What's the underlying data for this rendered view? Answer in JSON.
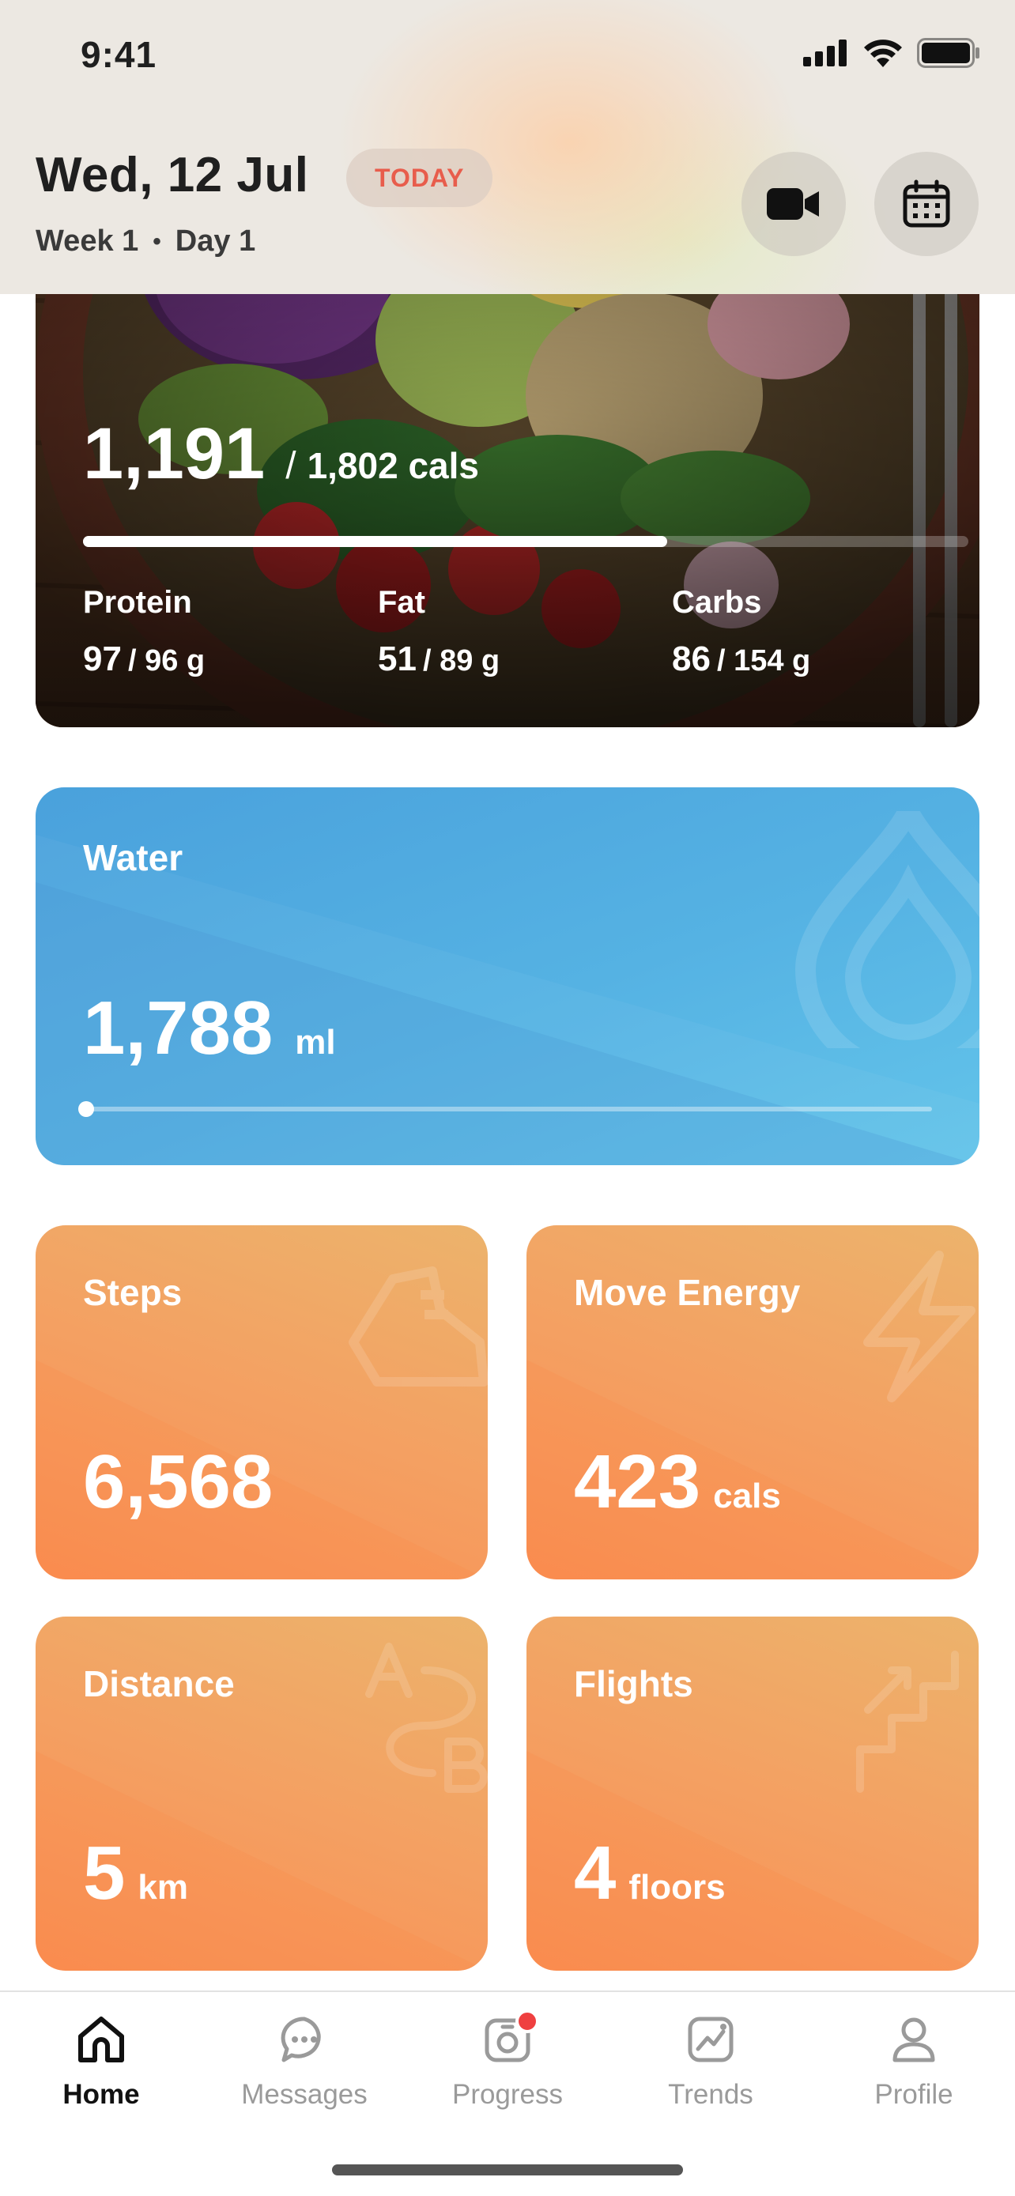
{
  "status_bar": {
    "time": "9:41"
  },
  "header": {
    "date": "Wed, 12 Jul",
    "today_badge": "TODAY",
    "week": "Week 1",
    "separator": "•",
    "day": "Day 1",
    "icons": [
      "video-camera-icon",
      "calendar-icon"
    ]
  },
  "nutrition": {
    "consumed": "1,191",
    "separator": "/",
    "goal": "1,802 cals",
    "progress_fraction": 0.66,
    "macros": [
      {
        "label": "Protein",
        "value": "97",
        "goal": "/ 96 g"
      },
      {
        "label": "Fat",
        "value": "51",
        "goal": "/ 89 g"
      },
      {
        "label": "Carbs",
        "value": "86",
        "goal": "/ 154 g"
      }
    ]
  },
  "water": {
    "title": "Water",
    "value": "1,788",
    "unit": "ml",
    "progress_fraction": 0.0,
    "icon": "water-drop-icon"
  },
  "tiles": {
    "steps": {
      "title": "Steps",
      "value": "6,568",
      "unit": "",
      "icon": "sneaker-icon"
    },
    "move_energy": {
      "title": "Move Energy",
      "value": "423",
      "unit": "cals",
      "icon": "lightning-icon"
    },
    "distance": {
      "title": "Distance",
      "value": "5",
      "unit": "km",
      "icon": "a-to-b-route-icon"
    },
    "flights": {
      "title": "Flights",
      "value": "4",
      "unit": "floors",
      "icon": "stairs-icon"
    }
  },
  "tabbar": {
    "tabs": [
      {
        "label": "Home",
        "icon": "home-icon",
        "active": true
      },
      {
        "label": "Messages",
        "icon": "chat-bubble-icon",
        "active": false
      },
      {
        "label": "Progress",
        "icon": "camera-progress-icon",
        "active": false,
        "badge": true
      },
      {
        "label": "Trends",
        "icon": "trend-chart-icon",
        "active": false
      },
      {
        "label": "Profile",
        "icon": "person-icon",
        "active": false
      }
    ]
  },
  "colors": {
    "today_badge_text": "#e85d4c",
    "water_card": "#4fa9df",
    "tile_orange": "#f59a5b",
    "badge_red": "#ef4040"
  }
}
